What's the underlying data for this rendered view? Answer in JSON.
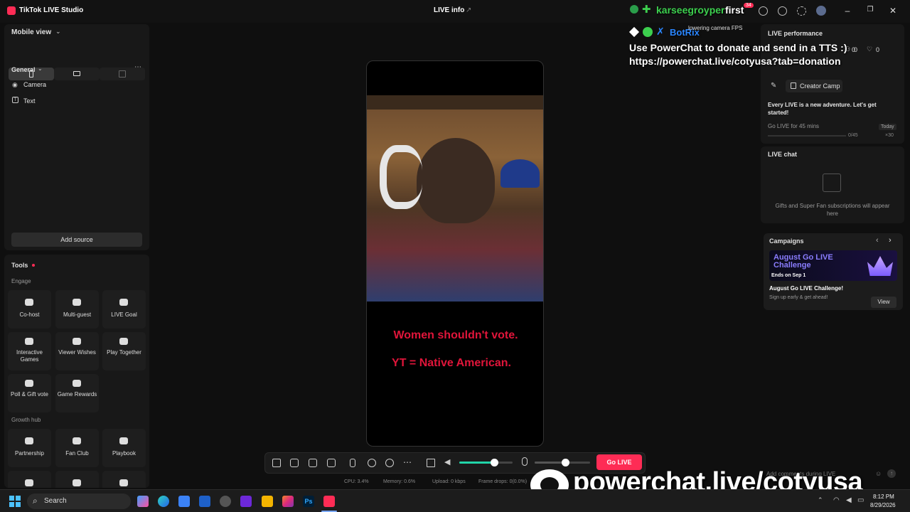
{
  "titlebar": {
    "app_title": "TikTok LIVE Studio",
    "live_info": "LIVE info"
  },
  "left": {
    "view_label": "Mobile view",
    "general_label": "General",
    "sources": [
      {
        "label": "Camera"
      },
      {
        "label": "Text"
      }
    ],
    "add_source": "Add source",
    "tools_label": "Tools",
    "engage_label": "Engage",
    "engage_tools": [
      {
        "label": "Co-host"
      },
      {
        "label": "Multi-guest"
      },
      {
        "label": "LIVE Goal"
      },
      {
        "label": "Interactive Games"
      },
      {
        "label": "Viewer Wishes"
      },
      {
        "label": "Play Together"
      },
      {
        "label": "Poll & Gift vote"
      },
      {
        "label": "Game Rewards"
      }
    ],
    "growth_label": "Growth hub",
    "growth_tools": [
      {
        "label": "Partnership"
      },
      {
        "label": "Fan Club"
      },
      {
        "label": "Playbook"
      }
    ]
  },
  "preview": {
    "line1": "Women shouldn't vote.",
    "line2": "YT = Native American."
  },
  "controls": {
    "go_live": "Go LIVE",
    "volume_level": 0.65,
    "mic_level": 0.55
  },
  "stats": {
    "cpu": "CPU: 3.4%",
    "memory": "Memory: 0.6%",
    "upload": "Upload: 0 kbps",
    "frame_drops": "Frame drops: 0(0.0%)"
  },
  "overlay": {
    "user": "karseegroyper",
    "first": "first",
    "badge_count": "34",
    "bot_name": "BotRix",
    "camera_notice": "lowering camera FPS",
    "message_line1": "Use PowerChat to donate and send in a TTS :)",
    "message_line2": "https://powerchat.live/cotyusa?tab=donation",
    "watermark": "powerchat.live/cotyusa"
  },
  "right": {
    "perf_title": "LIVE performance",
    "perf_stats": [
      "0",
      "0",
      "0",
      "0"
    ],
    "creator_camp": "Creator Camp",
    "adventure": "Every LIVE is a new adventure. Let's get started!",
    "goal_label": "Go LIVE for 45 mins",
    "goal_today": "Today",
    "goal_progress": "0/45",
    "goal_reward": "×30",
    "chat_title": "LIVE chat",
    "chat_empty": "Gifts and Super Fan subscriptions will appear here",
    "campaigns_title": "Campaigns",
    "banner_title": "August Go LIVE Challenge",
    "banner_ends": "Ends on Sep 1",
    "campaign_name": "August Go LIVE Challenge!",
    "campaign_sub": "Sign up early & get ahead!",
    "view_button": "View",
    "comment_placeholder": "Add comments during LIVE"
  },
  "taskbar": {
    "search": "Search",
    "time": "8:12 PM",
    "date": "8/29/2026"
  },
  "colors": {
    "accent": "#fe2c55",
    "overlay_red": "#e0153a",
    "bot_blue": "#2a86ff"
  }
}
